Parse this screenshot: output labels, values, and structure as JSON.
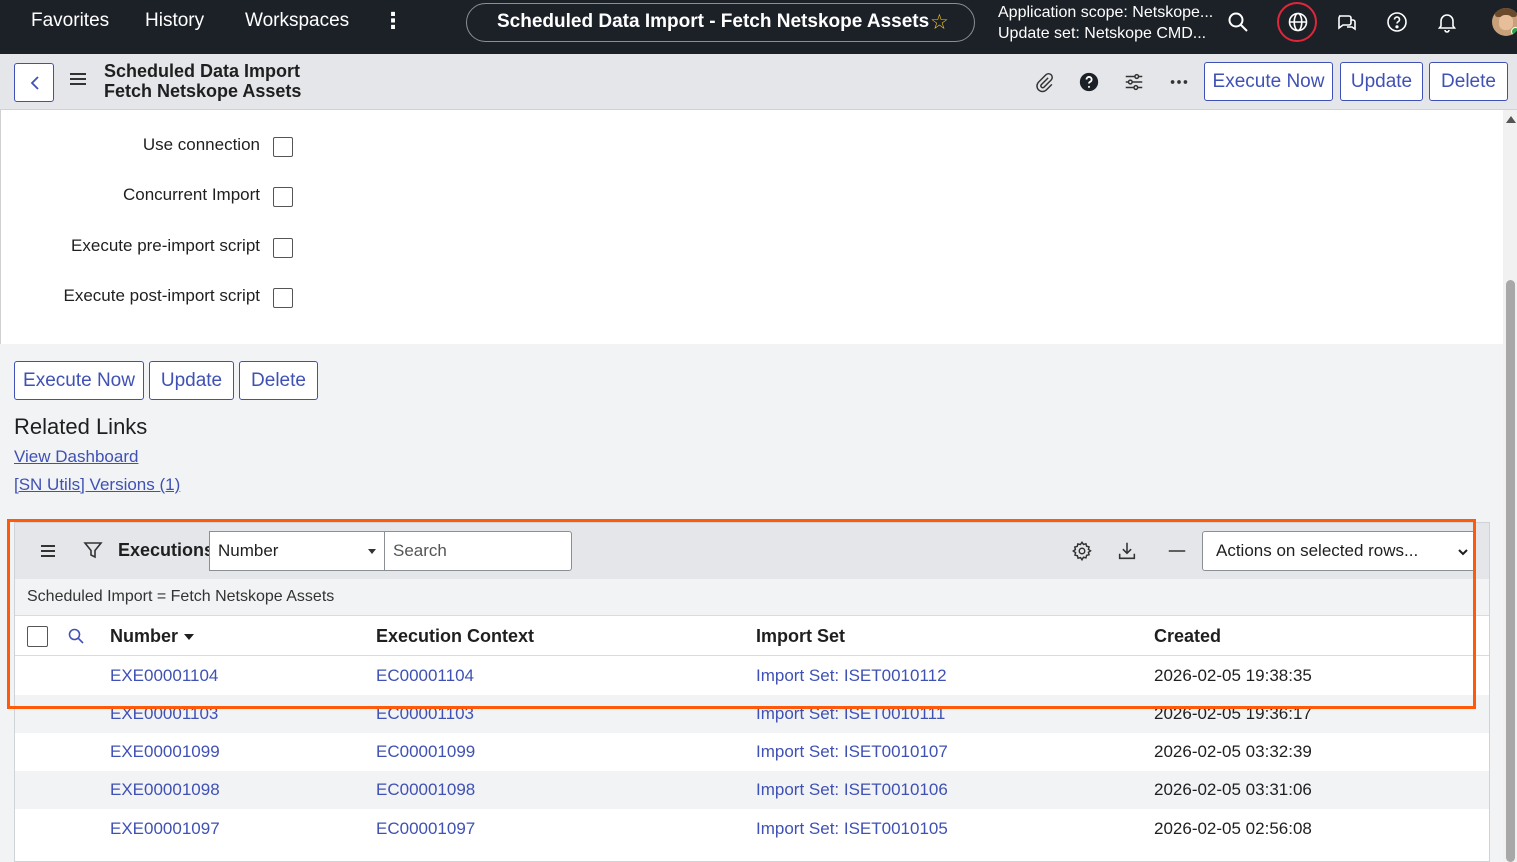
{
  "nav": {
    "links": [
      "Favorites",
      "History",
      "Workspaces"
    ],
    "pill_title": "Scheduled Data Import - Fetch Netskope Assets",
    "scope_line1": "Application scope: Netskope...",
    "scope_line2": "Update set: Netskope CMD..."
  },
  "header": {
    "title_line1": "Scheduled Data Import",
    "title_line2": "Fetch Netskope Assets",
    "buttons": [
      "Execute Now",
      "Update",
      "Delete"
    ]
  },
  "form": {
    "checkboxes": [
      {
        "label": "Use connection",
        "checked": false
      },
      {
        "label": "Concurrent Import",
        "checked": false
      },
      {
        "label": "Execute pre-import script",
        "checked": false
      },
      {
        "label": "Execute post-import script",
        "checked": false
      }
    ],
    "buttons": [
      "Execute Now",
      "Update",
      "Delete"
    ]
  },
  "related": {
    "title": "Related Links",
    "links": [
      "View Dashboard",
      "[SN Utils] Versions (1)"
    ]
  },
  "list": {
    "title": "Executions",
    "field_select": "Number",
    "search_placeholder": "Search",
    "actions_select": "Actions on selected rows...",
    "breadcrumb": "Scheduled Import = Fetch Netskope Assets",
    "columns": [
      "Number",
      "Execution Context",
      "Import Set",
      "Created"
    ],
    "sorted_column": "Number",
    "rows": [
      {
        "number": "EXE00001104",
        "context": "EC00001104",
        "import_set": "Import Set: ISET0010112",
        "created": "2026-02-05 19:38:35"
      },
      {
        "number": "EXE00001103",
        "context": "EC00001103",
        "import_set": "Import Set: ISET0010111",
        "created": "2026-02-05 19:36:17"
      },
      {
        "number": "EXE00001099",
        "context": "EC00001099",
        "import_set": "Import Set: ISET0010107",
        "created": "2026-02-05 03:32:39"
      },
      {
        "number": "EXE00001098",
        "context": "EC00001098",
        "import_set": "Import Set: ISET0010106",
        "created": "2026-02-05 03:31:06"
      },
      {
        "number": "EXE00001097",
        "context": "EC00001097",
        "import_set": "Import Set: ISET0010105",
        "created": "2026-02-05 02:56:08"
      }
    ]
  },
  "colors": {
    "accent": "#3f51b5",
    "nav_bg": "#1c2127",
    "highlight": "#ff5a0a",
    "globe_ring": "#e0263a"
  },
  "icons": [
    "more-vertical-icon",
    "star-icon",
    "search-icon",
    "globe-icon",
    "chat-icon",
    "help-icon",
    "bell-icon",
    "paperclip-icon",
    "question-filled-icon",
    "settings-sliders-icon",
    "ellipsis-icon",
    "filter-icon",
    "gear-icon",
    "download-icon",
    "minus-icon"
  ]
}
